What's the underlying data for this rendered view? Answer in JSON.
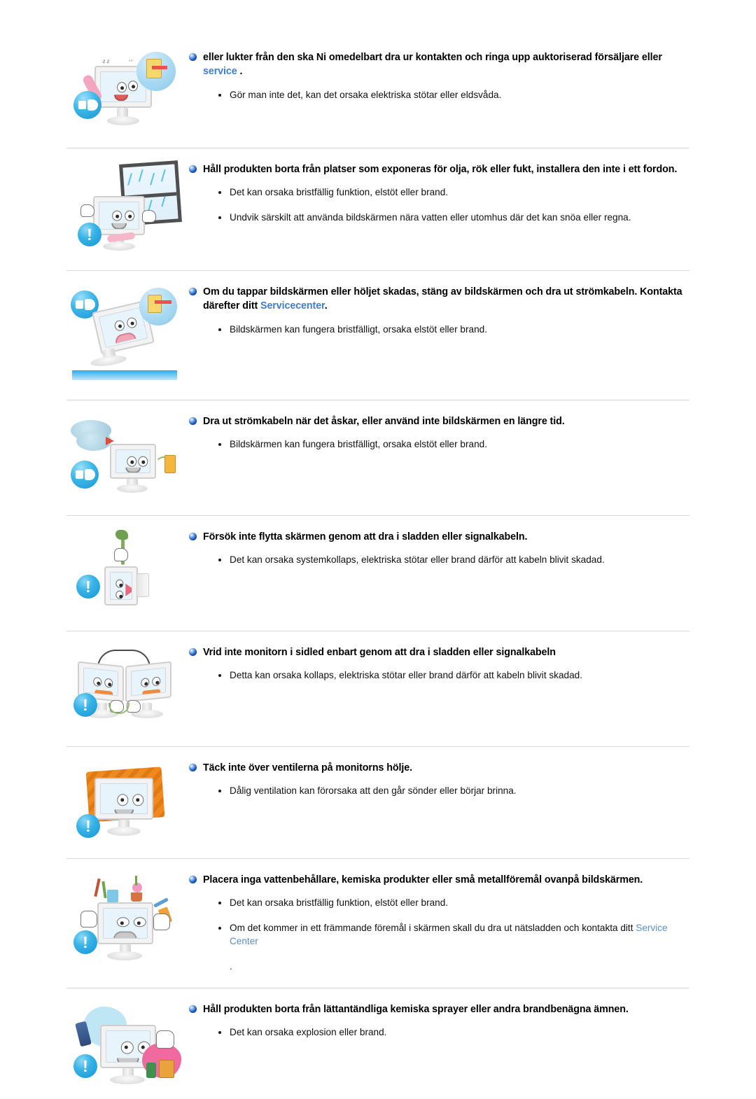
{
  "document": {
    "language": "sv",
    "accent_link_color": "#3f7fd0",
    "bullet_orb_color": "#1450b4",
    "warning_badge_color": "#1795d4",
    "divider_color": "#d8d8d8"
  },
  "sections": [
    {
      "id": "odor-unplug",
      "illustration": "monitor-smoke-phone-unplug",
      "heading_parts": [
        {
          "text": "eller lukter från den ska Ni omedelbart dra ur kontakten och ringa upp auktoriserad försäljare eller ",
          "link": false
        },
        {
          "text": "service",
          "link": true
        },
        {
          "text": " .",
          "link": false
        }
      ],
      "heading_plain": "eller lukter från den ska Ni omedelbart dra ur kontakten och ringa upp auktoriserad försäljare eller service .",
      "bullets": [
        {
          "text": "Gör man inte det, kan det orsaka elektriska stötar eller eldsvåda."
        }
      ]
    },
    {
      "id": "avoid-oil-smoke-moisture",
      "illustration": "monitor-rain-window",
      "heading_parts": [
        {
          "text": "Håll produkten borta från platser som exponeras för olja, rök eller fukt, installera den inte i ett fordon.",
          "link": false
        }
      ],
      "heading_plain": "Håll produkten borta från platser som exponeras för olja, rök eller fukt, installera den inte i ett fordon.",
      "bullets": [
        {
          "text": "Det kan orsaka bristfällig funktion, elstöt eller brand."
        },
        {
          "text": "Undvik särskilt att använda bildskärmen nära vatten eller utomhus där det kan snöa eller regna."
        }
      ]
    },
    {
      "id": "dropped-monitor",
      "illustration": "monitor-falling-unplug",
      "heading_parts": [
        {
          "text": "Om du tappar bildskärmen eller höljet skadas, stäng av bildskärmen och dra ut strömkabeln. Kontakta därefter ditt ",
          "link": false
        },
        {
          "text": "Servicecenter",
          "link": true
        },
        {
          "text": ".",
          "link": false
        }
      ],
      "heading_plain": "Om du tappar bildskärmen eller höljet skadas, stäng av bildskärmen och dra ut strömkabeln. Kontakta därefter ditt Servicecenter.",
      "bullets": [
        {
          "text": "Bildskärmen kan fungera bristfälligt, orsaka elstöt eller brand."
        }
      ]
    },
    {
      "id": "thunderstorm-unplug",
      "illustration": "monitor-thunderstorm-unplug",
      "heading_parts": [
        {
          "text": "Dra ut strömkabeln när det åskar, eller använd inte bildskärmen en längre tid.",
          "link": false
        }
      ],
      "heading_plain": "Dra ut strömkabeln när det åskar, eller använd inte bildskärmen en längre tid.",
      "bullets": [
        {
          "text": "Bildskärmen kan fungera bristfälligt, orsaka elstöt eller brand."
        }
      ]
    },
    {
      "id": "dont-move-by-cable",
      "illustration": "monitor-hanging-by-cable",
      "heading_parts": [
        {
          "text": "Försök inte flytta skärmen genom att dra i sladden eller signalkabeln.",
          "link": false
        }
      ],
      "heading_plain": "Försök inte flytta skärmen genom att dra i sladden eller signalkabeln.",
      "bullets": [
        {
          "text": "Det kan orsaka systemkollaps, elektriska stötar eller brand därför att kabeln blivit skadad."
        }
      ]
    },
    {
      "id": "dont-swivel-by-cable",
      "illustration": "two-monitors-swivel-cable",
      "heading_parts": [
        {
          "text": "Vrid inte monitorn i sidled enbart genom att dra i sladden eller signalkabeln",
          "link": false
        }
      ],
      "heading_plain": "Vrid inte monitorn i sidled enbart genom att dra i sladden eller signalkabeln",
      "bullets": [
        {
          "text": "Detta kan orsaka kollaps, elektriska stötar eller brand därför att kabeln blivit skadad."
        }
      ]
    },
    {
      "id": "dont-cover-vents",
      "illustration": "monitor-covered-with-cloth",
      "heading_parts": [
        {
          "text": "Täck inte över ventilerna på monitorns hölje.",
          "link": false
        }
      ],
      "heading_plain": "Täck inte över ventilerna på monitorns hölje.",
      "bullets": [
        {
          "text": "Dålig ventilation kan förorsaka att den går sönder eller börjar brinna."
        }
      ]
    },
    {
      "id": "no-objects-on-top",
      "illustration": "monitor-objects-on-top",
      "heading_parts": [
        {
          "text": "Placera inga vattenbehållare, kemiska produkter eller små metallföremål ovanpå bildskärmen.",
          "link": false
        }
      ],
      "heading_plain": "Placera inga vattenbehållare, kemiska produkter eller små metallföremål ovanpå bildskärmen.",
      "bullets": [
        {
          "text": "Det kan orsaka bristfällig funktion, elstöt eller brand."
        },
        {
          "parts": [
            {
              "text": "Om det kommer in ett främmande föremål i skärmen skall du dra ut nätsladden och kontakta ditt ",
              "link": false
            },
            {
              "text": "Service Center",
              "link": true
            }
          ],
          "text": "Om det kommer in ett främmande föremål i skärmen skall du dra ut nätsladden och kontakta ditt Service Center",
          "trailing": "."
        }
      ]
    },
    {
      "id": "no-flammable-sprays",
      "illustration": "monitor-spray-chemicals",
      "heading_parts": [
        {
          "text": "Håll produkten borta från lättantändliga kemiska sprayer eller andra brandbenägna ämnen.",
          "link": false
        }
      ],
      "heading_plain": "Håll produkten borta från lättantändliga kemiska sprayer eller andra brandbenägna ämnen.",
      "bullets": [
        {
          "text": "Det kan orsaka explosion eller brand."
        }
      ]
    }
  ],
  "icons": {
    "warning_glyph": "!",
    "orb": "blue-orb-bullet",
    "unplug": "unplug-hand-icon"
  }
}
